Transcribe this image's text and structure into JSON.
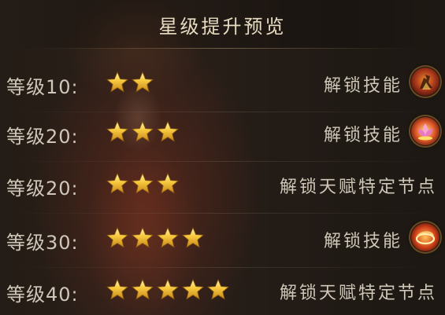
{
  "title": "星级提升预览",
  "colors": {
    "text": "#cfc7b8",
    "title": "#e7dcc2",
    "star": "#f3c23a"
  },
  "rows": [
    {
      "level": "等级10:",
      "stars": 2,
      "reward": "解锁技能",
      "icon": "warrior-skill-icon"
    },
    {
      "level": "等级20:",
      "stars": 3,
      "reward": "解锁技能",
      "icon": "lotus-skill-icon"
    },
    {
      "level": "等级20:",
      "stars": 3,
      "reward": "解锁天赋特定节点",
      "icon": ""
    },
    {
      "level": "等级30:",
      "stars": 4,
      "reward": "解锁技能",
      "icon": "flame-ring-skill-icon"
    },
    {
      "level": "等级40:",
      "stars": 5,
      "reward": "解锁天赋特定节点",
      "icon": ""
    }
  ]
}
